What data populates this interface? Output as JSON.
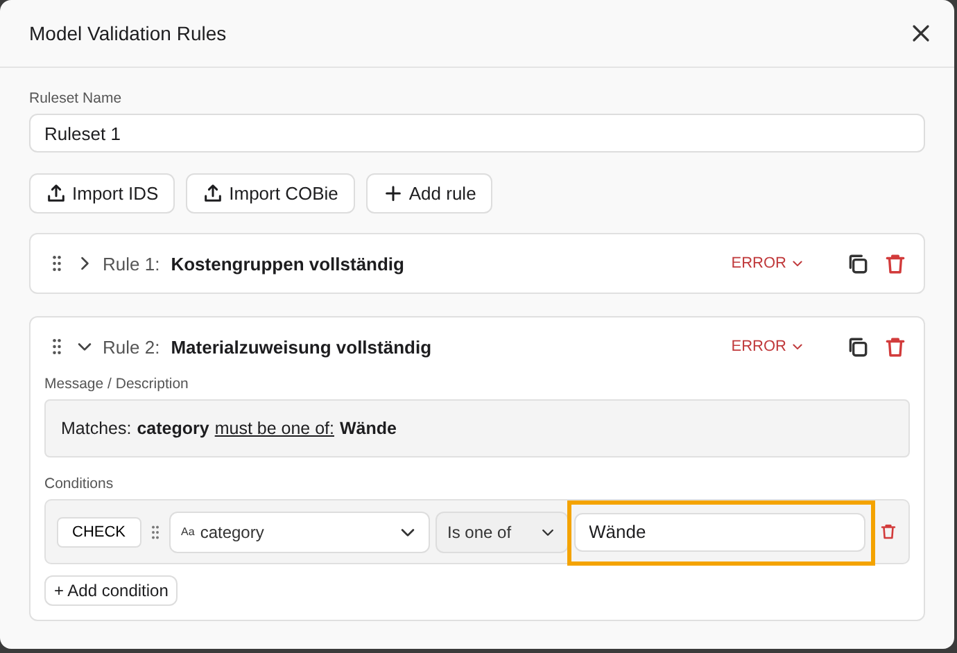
{
  "dialog": {
    "title": "Model Validation Rules"
  },
  "ruleset": {
    "label": "Ruleset Name",
    "value": "Ruleset 1"
  },
  "toolbar": [
    {
      "kind": "upload",
      "label": "Import IDS"
    },
    {
      "kind": "upload",
      "label": "Import COBie"
    },
    {
      "kind": "add",
      "label": "Add rule"
    }
  ],
  "rules": [
    {
      "number": "Rule 1:",
      "name": "Kostengruppen vollständig",
      "expanded": false,
      "severity": "ERROR"
    },
    {
      "number": "Rule 2:",
      "name": "Materialzuweisung vollständig",
      "expanded": true,
      "severity": "ERROR",
      "message_label": "Message / Description",
      "message": [
        {
          "kind": "plain",
          "text": "Matches:"
        },
        {
          "kind": "field",
          "text": "category"
        },
        {
          "kind": "operator",
          "text": "must be one of:"
        },
        {
          "kind": "field",
          "text": "Wände"
        }
      ],
      "conditions_label": "Conditions",
      "conditions": [
        {
          "check": "CHECK",
          "type_icon": "Aa",
          "field": "category",
          "operator": "Is one of",
          "value": "Wände",
          "highlighted": true
        }
      ],
      "add_condition": "+ Add condition"
    }
  ]
}
